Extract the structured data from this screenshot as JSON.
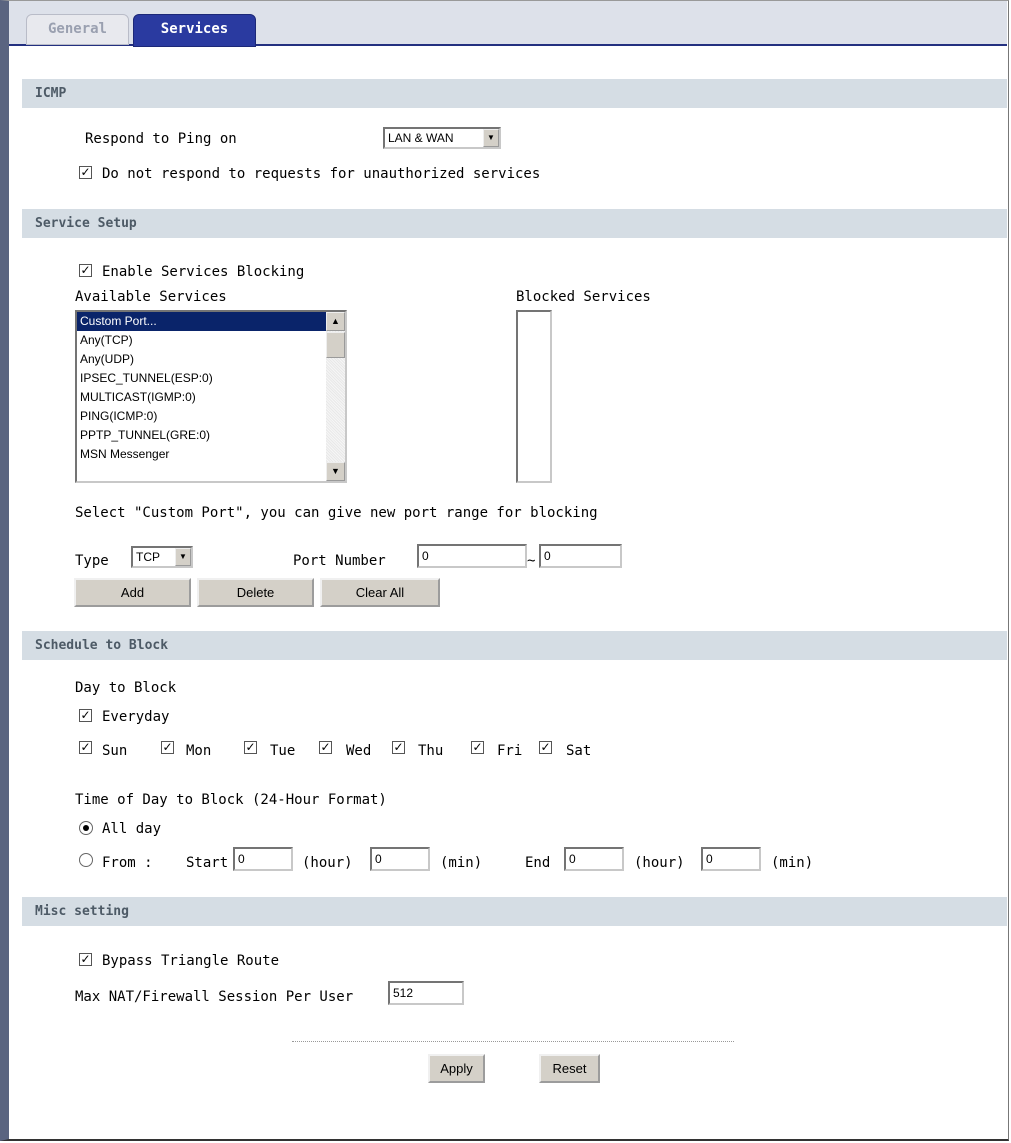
{
  "tabs": [
    {
      "label": "General",
      "active": false
    },
    {
      "label": "Services",
      "active": true
    }
  ],
  "icmp": {
    "heading": "ICMP",
    "respond_label": "Respond to Ping on",
    "respond_value": "LAN & WAN",
    "no_respond_label": "Do not respond to requests for unauthorized services",
    "no_respond_checked": true
  },
  "service_setup": {
    "heading": "Service Setup",
    "enable_label": "Enable Services Blocking",
    "enable_checked": true,
    "available_label": "Available Services",
    "blocked_label": "Blocked Services",
    "available_services": [
      "Custom Port...",
      "Any(TCP)",
      "Any(UDP)",
      "IPSEC_TUNNEL(ESP:0)",
      "MULTICAST(IGMP:0)",
      "PING(ICMP:0)",
      "PPTP_TUNNEL(GRE:0)",
      "MSN Messenger"
    ],
    "selected_service": "Custom Port...",
    "custom_hint": "Select \"Custom Port\", you can give new port range for blocking",
    "type_label": "Type",
    "type_value": "TCP",
    "port_label": "Port Number",
    "port_from": "0",
    "tilde": "~",
    "port_to": "0",
    "add_label": "Add",
    "delete_label": "Delete",
    "clear_label": "Clear All"
  },
  "schedule": {
    "heading": "Schedule to Block",
    "day_label": "Day to Block",
    "everyday_label": "Everyday",
    "everyday_checked": true,
    "days": [
      "Sun",
      "Mon",
      "Tue",
      "Wed",
      "Thu",
      "Fri",
      "Sat"
    ],
    "time_label": "Time of Day to Block (24-Hour Format)",
    "all_day_label": "All day",
    "all_day_selected": true,
    "from_label": "From :",
    "start_label": "Start",
    "end_label": "End",
    "hour_unit": "(hour)",
    "min_unit": "(min)",
    "start_hour": "0",
    "start_min": "0",
    "end_hour": "0",
    "end_min": "0"
  },
  "misc": {
    "heading": "Misc setting",
    "bypass_label": "Bypass Triangle Route",
    "bypass_checked": true,
    "max_nat_label": "Max NAT/Firewall Session Per User",
    "max_nat_value": "512"
  },
  "actions": {
    "apply_label": "Apply",
    "reset_label": "Reset"
  },
  "icons": {
    "check_glyph": "☑",
    "dropdown_glyph": "▼",
    "scroll_up_glyph": "▲",
    "scroll_down_glyph": "▼"
  }
}
